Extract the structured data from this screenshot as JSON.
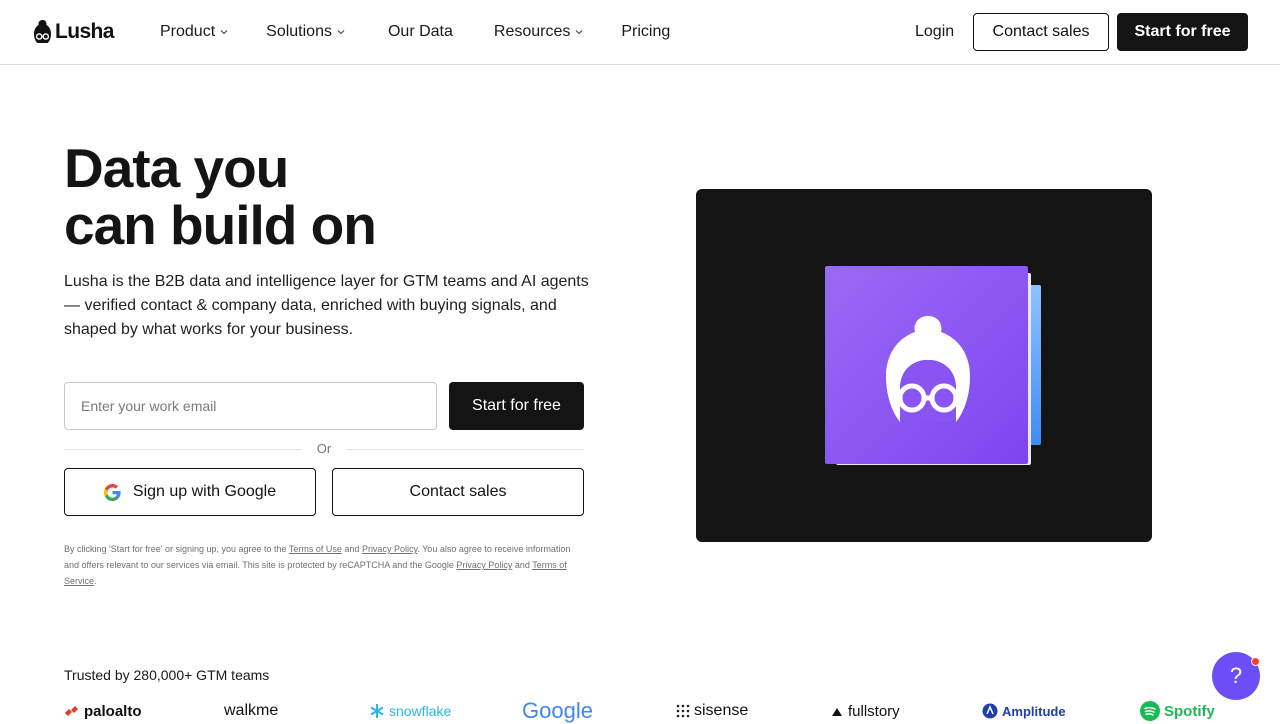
{
  "nav": {
    "logo_text": "Lusha",
    "items": [
      {
        "label": "Product",
        "has_dropdown": true
      },
      {
        "label": "Solutions",
        "has_dropdown": true
      },
      {
        "label": "Our Data",
        "has_dropdown": false
      },
      {
        "label": "Resources",
        "has_dropdown": true
      },
      {
        "label": "Pricing",
        "has_dropdown": false
      }
    ],
    "login": "Login",
    "contact_sales": "Contact sales",
    "start_free": "Start for free"
  },
  "hero": {
    "title_line1": "Data you",
    "title_line2": "can build on",
    "description": "Lusha is the B2B data and intelligence layer for GTM teams and AI agents — verified contact & company data, enriched with buying signals, and shaped by what works for your business.",
    "email_placeholder": "Enter your work email",
    "email_value": "",
    "start_button": "Start for free",
    "or_text": "Or",
    "google_button": "Sign up with Google",
    "contact_button": "Contact sales",
    "legal": {
      "part1": "By clicking 'Start for free' or signing up, you agree to the ",
      "terms_of_use": "Terms of Use",
      "and1": " and ",
      "privacy_policy": "Privacy Policy",
      "part2": ". You also agree to receive information and offers relevant to our services via email. This site is protected by reCAPTCHA and the Google ",
      "google_privacy": "Privacy Policy",
      "and2": " and ",
      "terms_of_service": "Terms of Service",
      "end": "."
    }
  },
  "trusted": {
    "label": "Trusted by 280,000+ GTM teams",
    "logos": [
      "paloalto",
      "walkme",
      "snowflake",
      "Google",
      "sisense",
      "fullstory",
      "Amplitude",
      "Spotify"
    ]
  },
  "help": {
    "icon": "question-icon",
    "label": "?"
  },
  "colors": {
    "primary_dark": "#141414",
    "accent_purple": "#8a54f2",
    "help_bubble": "#6b4ef5",
    "notification_dot": "#ff3b30"
  }
}
